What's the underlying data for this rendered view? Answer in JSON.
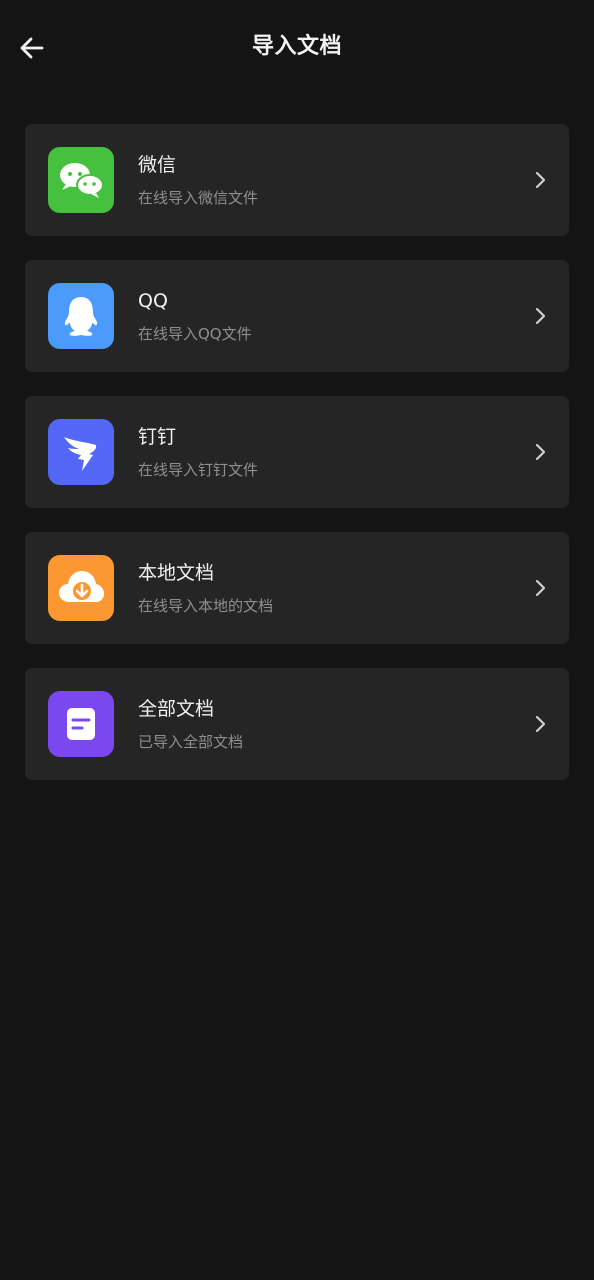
{
  "header": {
    "title": "导入文档",
    "back_icon": "arrow-left-icon"
  },
  "colors": {
    "background": "#141414",
    "card": "#252525",
    "wechat": "#45c13f",
    "qq": "#4b9bfa",
    "dingtalk": "#5567f6",
    "local": "#fb9832",
    "all": "#7b47f0"
  },
  "items": [
    {
      "title": "微信",
      "subtitle": "在线导入微信文件",
      "icon": "wechat-icon"
    },
    {
      "title": "QQ",
      "subtitle": "在线导入QQ文件",
      "icon": "qq-icon"
    },
    {
      "title": "钉钉",
      "subtitle": "在线导入钉钉文件",
      "icon": "dingtalk-icon"
    },
    {
      "title": "本地文档",
      "subtitle": "在线导入本地的文档",
      "icon": "cloud-download-icon"
    },
    {
      "title": "全部文档",
      "subtitle": "已导入全部文档",
      "icon": "document-icon"
    }
  ]
}
